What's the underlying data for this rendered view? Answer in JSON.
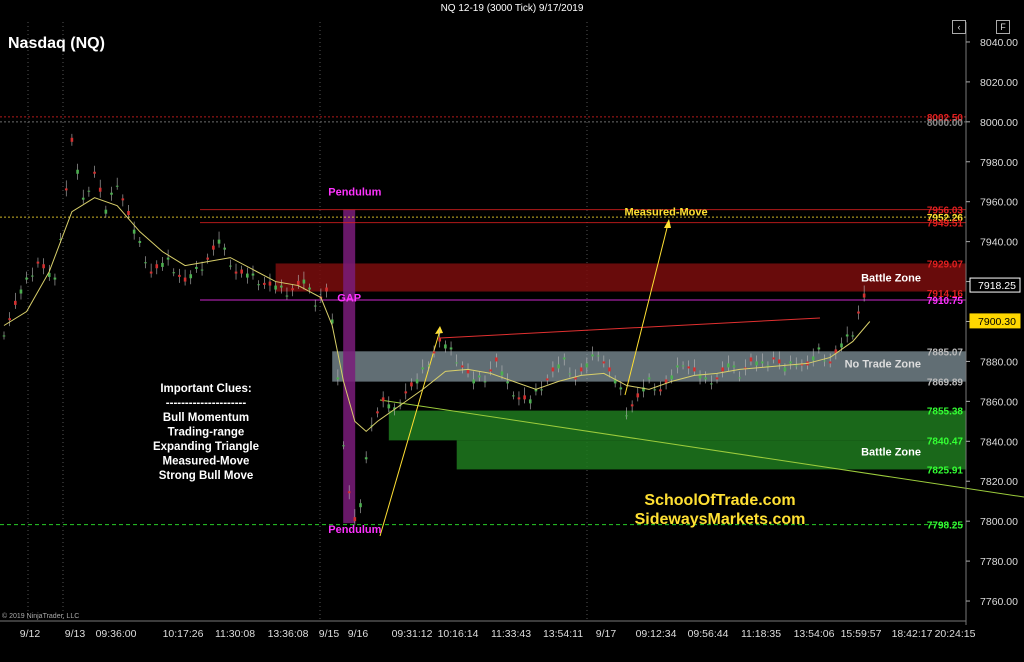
{
  "window": {
    "title": "NQ 12-19 (3000 Tick)  9/17/2019",
    "btn_chevron": "‹",
    "btn_f": "F"
  },
  "colors": {
    "background": "#000000",
    "bull": "#4caf50",
    "bear": "#d32f2f",
    "ma": "#d8cf6a",
    "battle_red": "#7a0d0d",
    "no_trade": "#b0c8d4",
    "battle_green": "#1e7a1e",
    "pendulum": "#7a1c7a",
    "magenta_text": "#ff33ff",
    "yellow_text": "#ffe033"
  },
  "chart_data": {
    "type": "candlestick",
    "title": "Nasdaq (NQ)",
    "watermark": "© 2019 NinjaTrader, LLC",
    "ylim": [
      7750,
      8050
    ],
    "y_ticks": [
      8040.0,
      8020.0,
      8000.0,
      7980.0,
      7960.0,
      7940.0,
      7920.0,
      7900.0,
      7880.0,
      7860.0,
      7840.0,
      7820.0,
      7800.0,
      7780.0,
      7760.0
    ],
    "x_tick_labels": [
      "9/12",
      "9/13",
      "09:36:00",
      "10:17:26",
      "11:30:08",
      "13:36:08",
      "9/15",
      "9/16",
      "09:31:12",
      "10:16:14",
      "11:33:43",
      "13:54:11",
      "9/17",
      "09:12:34",
      "09:56:44",
      "11:18:35",
      "13:54:06",
      "15:59:57",
      "18:42:17",
      "20:24:15"
    ],
    "price_series": [
      {
        "x": 0,
        "y": 7895
      },
      {
        "x": 3,
        "y": 7915
      },
      {
        "x": 6,
        "y": 7930
      },
      {
        "x": 9,
        "y": 7920
      },
      {
        "x": 12,
        "y": 7990
      },
      {
        "x": 14,
        "y": 7960
      },
      {
        "x": 16,
        "y": 7975
      },
      {
        "x": 18,
        "y": 7955
      },
      {
        "x": 20,
        "y": 7970
      },
      {
        "x": 23,
        "y": 7945
      },
      {
        "x": 26,
        "y": 7925
      },
      {
        "x": 29,
        "y": 7930
      },
      {
        "x": 32,
        "y": 7920
      },
      {
        "x": 35,
        "y": 7928
      },
      {
        "x": 38,
        "y": 7940
      },
      {
        "x": 41,
        "y": 7925
      },
      {
        "x": 44,
        "y": 7922
      },
      {
        "x": 47,
        "y": 7918
      },
      {
        "x": 50,
        "y": 7915
      },
      {
        "x": 53,
        "y": 7920
      },
      {
        "x": 55,
        "y": 7910
      },
      {
        "x": 57,
        "y": 7915
      },
      {
        "x": 58,
        "y": 7900
      },
      {
        "x": 59,
        "y": 7870
      },
      {
        "x": 60,
        "y": 7840
      },
      {
        "x": 61,
        "y": 7815
      },
      {
        "x": 62,
        "y": 7800
      },
      {
        "x": 63,
        "y": 7808
      },
      {
        "x": 64,
        "y": 7830
      },
      {
        "x": 65,
        "y": 7850
      },
      {
        "x": 67,
        "y": 7860
      },
      {
        "x": 69,
        "y": 7855
      },
      {
        "x": 71,
        "y": 7865
      },
      {
        "x": 73,
        "y": 7870
      },
      {
        "x": 75,
        "y": 7880
      },
      {
        "x": 77,
        "y": 7890
      },
      {
        "x": 79,
        "y": 7885
      },
      {
        "x": 81,
        "y": 7878
      },
      {
        "x": 83,
        "y": 7870
      },
      {
        "x": 85,
        "y": 7872
      },
      {
        "x": 87,
        "y": 7880
      },
      {
        "x": 89,
        "y": 7868
      },
      {
        "x": 91,
        "y": 7862
      },
      {
        "x": 93,
        "y": 7860
      },
      {
        "x": 95,
        "y": 7868
      },
      {
        "x": 97,
        "y": 7875
      },
      {
        "x": 99,
        "y": 7880
      },
      {
        "x": 101,
        "y": 7872
      },
      {
        "x": 103,
        "y": 7878
      },
      {
        "x": 105,
        "y": 7885
      },
      {
        "x": 107,
        "y": 7875
      },
      {
        "x": 109,
        "y": 7865
      },
      {
        "x": 110,
        "y": 7855
      },
      {
        "x": 112,
        "y": 7862
      },
      {
        "x": 114,
        "y": 7870
      },
      {
        "x": 116,
        "y": 7866
      },
      {
        "x": 118,
        "y": 7872
      },
      {
        "x": 120,
        "y": 7880
      },
      {
        "x": 122,
        "y": 7875
      },
      {
        "x": 124,
        "y": 7870
      },
      {
        "x": 126,
        "y": 7872
      },
      {
        "x": 128,
        "y": 7878
      },
      {
        "x": 130,
        "y": 7874
      },
      {
        "x": 132,
        "y": 7880
      },
      {
        "x": 134,
        "y": 7878
      },
      {
        "x": 136,
        "y": 7882
      },
      {
        "x": 138,
        "y": 7876
      },
      {
        "x": 140,
        "y": 7880
      },
      {
        "x": 142,
        "y": 7878
      },
      {
        "x": 144,
        "y": 7885
      },
      {
        "x": 146,
        "y": 7880
      },
      {
        "x": 148,
        "y": 7888
      },
      {
        "x": 150,
        "y": 7895
      },
      {
        "x": 151,
        "y": 7905
      },
      {
        "x": 152,
        "y": 7912
      },
      {
        "x": 153,
        "y": 7918
      }
    ],
    "ma_series": [
      {
        "x": 0,
        "y": 7898
      },
      {
        "x": 4,
        "y": 7905
      },
      {
        "x": 8,
        "y": 7925
      },
      {
        "x": 12,
        "y": 7955
      },
      {
        "x": 16,
        "y": 7962
      },
      {
        "x": 20,
        "y": 7958
      },
      {
        "x": 24,
        "y": 7945
      },
      {
        "x": 28,
        "y": 7935
      },
      {
        "x": 32,
        "y": 7928
      },
      {
        "x": 36,
        "y": 7930
      },
      {
        "x": 40,
        "y": 7932
      },
      {
        "x": 44,
        "y": 7926
      },
      {
        "x": 48,
        "y": 7920
      },
      {
        "x": 52,
        "y": 7918
      },
      {
        "x": 56,
        "y": 7912
      },
      {
        "x": 58,
        "y": 7898
      },
      {
        "x": 60,
        "y": 7870
      },
      {
        "x": 62,
        "y": 7850
      },
      {
        "x": 64,
        "y": 7845
      },
      {
        "x": 66,
        "y": 7850
      },
      {
        "x": 70,
        "y": 7858
      },
      {
        "x": 74,
        "y": 7866
      },
      {
        "x": 78,
        "y": 7875
      },
      {
        "x": 82,
        "y": 7876
      },
      {
        "x": 86,
        "y": 7874
      },
      {
        "x": 90,
        "y": 7870
      },
      {
        "x": 94,
        "y": 7866
      },
      {
        "x": 98,
        "y": 7870
      },
      {
        "x": 102,
        "y": 7873
      },
      {
        "x": 106,
        "y": 7874
      },
      {
        "x": 110,
        "y": 7868
      },
      {
        "x": 114,
        "y": 7866
      },
      {
        "x": 118,
        "y": 7870
      },
      {
        "x": 122,
        "y": 7873
      },
      {
        "x": 126,
        "y": 7874
      },
      {
        "x": 130,
        "y": 7876
      },
      {
        "x": 134,
        "y": 7877
      },
      {
        "x": 138,
        "y": 7878
      },
      {
        "x": 142,
        "y": 7879
      },
      {
        "x": 146,
        "y": 7882
      },
      {
        "x": 150,
        "y": 7890
      },
      {
        "x": 153,
        "y": 7900
      }
    ],
    "x_range": [
      0,
      170
    ],
    "zones": [
      {
        "name": "Battle Zone",
        "from": 7915.0,
        "to": 7929.07,
        "color": "battle_red",
        "label": "Battle Zone",
        "x_start": 48,
        "label_price": 7920
      },
      {
        "name": "No Trade Zone",
        "from": 7869.89,
        "to": 7885.07,
        "color": "no_trade",
        "label": "No Trade Zone",
        "x_start": 58,
        "label_price": 7877
      },
      {
        "name": "Battle Zone",
        "from": 7840.47,
        "to": 7855.38,
        "color": "battle_green",
        "label": "",
        "x_start": 68,
        "label_price": 0
      },
      {
        "name": "Battle Zone",
        "from": 7825.91,
        "to": 7840.47,
        "color": "battle_green",
        "label": "Battle Zone",
        "x_start": 80,
        "label_price": 7833
      }
    ],
    "levels": [
      {
        "price": 8002.5,
        "label": "8002.50",
        "color": "#e02020",
        "style": "dotted"
      },
      {
        "price": 8000.0,
        "label": "8000.00",
        "color": "#888888",
        "style": "dotted"
      },
      {
        "price": 7956.03,
        "label": "7956.03",
        "color": "#e02020",
        "style": "solid"
      },
      {
        "price": 7952.26,
        "label": "7952.26",
        "color": "#ffe033",
        "style": "dotted"
      },
      {
        "price": 7949.51,
        "label": "7949.51",
        "color": "#e02020",
        "style": "solid"
      },
      {
        "price": 7929.07,
        "label": "7929.07",
        "color": "#e02020",
        "style": "none"
      },
      {
        "price": 7914.16,
        "label": "7914.16",
        "color": "#e02020",
        "style": "none"
      },
      {
        "price": 7910.75,
        "label": "7910.75",
        "color": "#ff33ff",
        "style": "solid"
      },
      {
        "price": 7885.07,
        "label": "7885.07",
        "color": "#bbbbbb",
        "style": "none"
      },
      {
        "price": 7869.89,
        "label": "7869.89",
        "color": "#bbbbbb",
        "style": "none"
      },
      {
        "price": 7855.38,
        "label": "7855.38",
        "color": "#33ff33",
        "style": "none"
      },
      {
        "price": 7840.47,
        "label": "7840.47",
        "color": "#33ff33",
        "style": "none"
      },
      {
        "price": 7825.91,
        "label": "7825.91",
        "color": "#33ff33",
        "style": "none"
      },
      {
        "price": 7798.25,
        "label": "7798.25",
        "color": "#33ff33",
        "style": "dashed"
      }
    ],
    "price_tags": [
      {
        "price": 7918.25,
        "label": "7918.25",
        "bg": "#000000",
        "fg": "#ffffff",
        "border": "#ffffff"
      },
      {
        "price": 7900.3,
        "label": "7900.30",
        "bg": "#ffd700",
        "fg": "#000000",
        "border": "#ffd700"
      }
    ],
    "pendulum_bar": {
      "x": 61,
      "from": 7799,
      "to": 7956
    },
    "annotations": [
      {
        "text": "Pendulum",
        "x": 62,
        "price": 7963,
        "color": "#ff33ff"
      },
      {
        "text": "GAP",
        "x": 61,
        "price": 7910,
        "color": "#ff33ff"
      },
      {
        "text": "Pendulum",
        "x": 62,
        "price": 7794,
        "color": "#ff33ff"
      },
      {
        "text": "Measured-Move",
        "x": 117,
        "price": 7953,
        "color": "#ffe033"
      }
    ],
    "clues": {
      "title": "Important Clues:",
      "separator": "---------------------",
      "items": [
        "Bull Momentum",
        "Trading-range",
        "Expanding Triangle",
        "Measured-Move",
        "Strong Bull Move"
      ]
    },
    "branding": [
      "SchoolOfTrade.com",
      "SidewaysMarkets.com"
    ]
  }
}
